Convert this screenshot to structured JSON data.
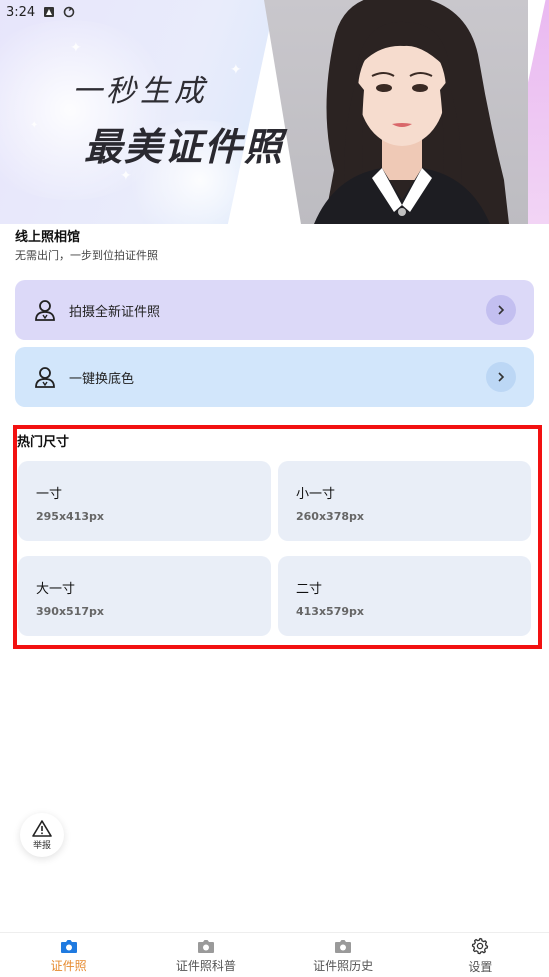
{
  "status_bar": {
    "time": "3:24"
  },
  "banner": {
    "slogan_line1": "一秒生成",
    "slogan_line2": "最美证件照"
  },
  "studio": {
    "title": "线上照相馆",
    "subtitle": "无需出门，一步到位拍证件照"
  },
  "actions": [
    {
      "label": "拍摄全新证件照",
      "icon": "person-icon"
    },
    {
      "label": "一键换底色",
      "icon": "person-icon"
    }
  ],
  "hot_sizes": {
    "title": "热门尺寸",
    "items": [
      {
        "name": "一寸",
        "dim": "295x413px"
      },
      {
        "name": "小一寸",
        "dim": "260x378px"
      },
      {
        "name": "大一寸",
        "dim": "390x517px"
      },
      {
        "name": "二寸",
        "dim": "413x579px"
      }
    ]
  },
  "report": {
    "label": "举报",
    "icon": "warning-icon"
  },
  "nav": [
    {
      "label": "证件照",
      "icon": "camera-icon",
      "active": true
    },
    {
      "label": "证件照科普",
      "icon": "camera-icon",
      "active": false
    },
    {
      "label": "证件照历史",
      "icon": "camera-icon",
      "active": false
    },
    {
      "label": "设置",
      "icon": "gear-icon",
      "active": false
    }
  ],
  "colors": {
    "accent": "#e68a2e",
    "highlight_border": "#f21111"
  }
}
